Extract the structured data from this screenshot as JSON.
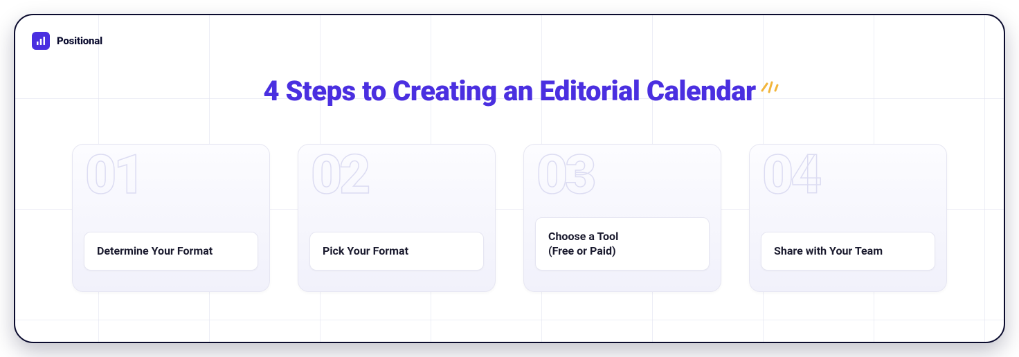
{
  "brand": {
    "name": "Positional"
  },
  "title": "4 Steps to Creating an Editorial Calendar",
  "accent_color": "#4a2fe0",
  "spark_color": "#f2b53a",
  "steps": [
    {
      "number": "01",
      "label": "Determine Your Format"
    },
    {
      "number": "02",
      "label": "Pick Your Format"
    },
    {
      "number": "03",
      "label": "Choose a Tool\n(Free or Paid)"
    },
    {
      "number": "04",
      "label": "Share with Your Team"
    }
  ]
}
